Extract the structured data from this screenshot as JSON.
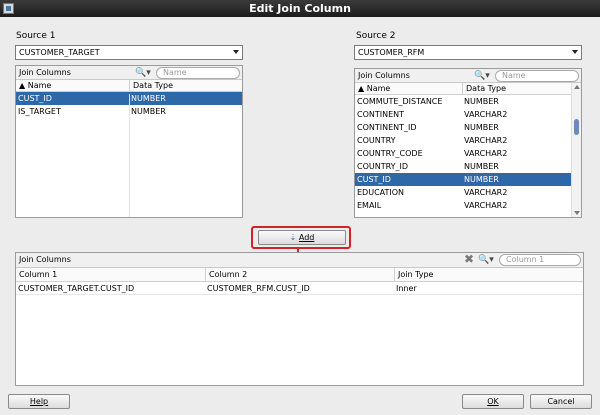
{
  "window": {
    "title": "Edit Join Column"
  },
  "source1": {
    "label": "Source 1",
    "selected": "CUSTOMER_TARGET",
    "panel_title": "Join Columns",
    "search_placeholder": "Name",
    "col_name": "Name",
    "col_type": "Data Type",
    "rows": [
      {
        "name": "CUST_ID",
        "type": "NUMBER",
        "selected": true
      },
      {
        "name": "IS_TARGET",
        "type": "NUMBER",
        "selected": false
      }
    ]
  },
  "source2": {
    "label": "Source 2",
    "selected": "CUSTOMER_RFM",
    "panel_title": "Join Columns",
    "search_placeholder": "Name",
    "col_name": "Name",
    "col_type": "Data Type",
    "rows": [
      {
        "name": "COMMUTE_DISTANCE",
        "type": "NUMBER",
        "selected": false
      },
      {
        "name": "CONTINENT",
        "type": "VARCHAR2",
        "selected": false
      },
      {
        "name": "CONTINENT_ID",
        "type": "NUMBER",
        "selected": false
      },
      {
        "name": "COUNTRY",
        "type": "VARCHAR2",
        "selected": false
      },
      {
        "name": "COUNTRY_CODE",
        "type": "VARCHAR2",
        "selected": false
      },
      {
        "name": "COUNTRY_ID",
        "type": "NUMBER",
        "selected": false
      },
      {
        "name": "CUST_ID",
        "type": "NUMBER",
        "selected": true
      },
      {
        "name": "EDUCATION",
        "type": "VARCHAR2",
        "selected": false
      },
      {
        "name": "EMAIL",
        "type": "VARCHAR2",
        "selected": false
      }
    ]
  },
  "add_button": {
    "label": "Add"
  },
  "join_columns": {
    "title": "Join Columns",
    "search_placeholder": "Column 1",
    "headers": [
      "Column 1",
      "Column 2",
      "Join Type"
    ],
    "rows": [
      [
        "CUSTOMER_TARGET.CUST_ID",
        "CUSTOMER_RFM.CUST_ID",
        "Inner"
      ]
    ]
  },
  "footer": {
    "help": "Help",
    "ok": "OK",
    "cancel": "Cancel"
  }
}
